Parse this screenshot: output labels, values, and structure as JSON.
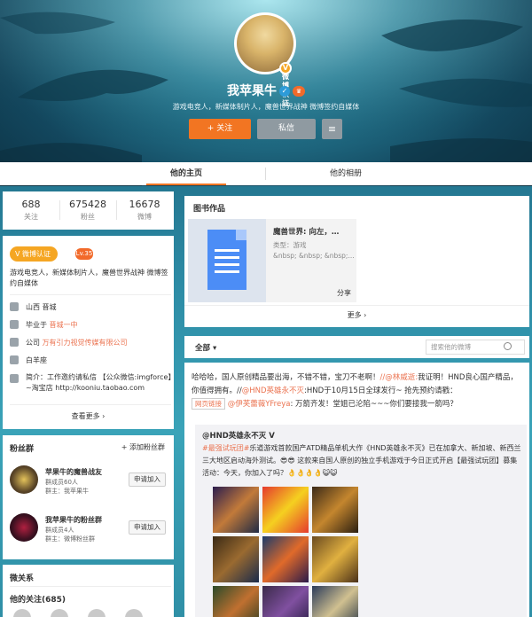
{
  "profile": {
    "username": "我苹果牛",
    "bio": "游戏电竞人，新媒体制片人，魔兽世界战神 微博签约自媒体",
    "follow_label": "+ 关注",
    "message_label": "私信",
    "menu_icon": "≡",
    "verified_icon": "✓",
    "level_icon": "♛"
  },
  "tabs": [
    "他的主页",
    "他的相册"
  ],
  "stats": [
    {
      "value": "688",
      "label": "关注"
    },
    {
      "value": "675428",
      "label": "粉丝"
    },
    {
      "value": "16678",
      "label": "微博"
    }
  ],
  "info": {
    "verified_label": "V 微博认证",
    "level_label": "Lv.35",
    "bio": "游戏电竞人，新媒体制片人，魔兽世界战神 微博签约自媒体",
    "location": "山西 晋城",
    "school_prefix": "毕业于 ",
    "school": "晋城一中",
    "company_prefix": "公司 ",
    "company": "万有引力视觉传媒有限公司",
    "sign": "白羊座",
    "intro": "简介：工作邀约请私信 【公众微信:imgforce】~淘宝店 http://kooniu.taobao.com",
    "more": "查看更多 ›"
  },
  "fans": {
    "title": "粉丝群",
    "add_label": "+ 添加粉丝群",
    "groups": [
      {
        "name": "苹果牛的魔兽战友",
        "members": "群成员60人",
        "owner": "群主：我苹果牛",
        "join": "申请加入"
      },
      {
        "name": "我苹果牛的粉丝群",
        "members": "群成员4人",
        "owner": "群主：微博粉丝群",
        "join": "申请加入"
      }
    ]
  },
  "relations": {
    "title": "微关系",
    "following": "他的关注(685)"
  },
  "books": {
    "title": "图书作品",
    "book_title": "魔兽世界: 向左，…",
    "book_type": "类型：游戏",
    "book_extra": "&nbsp; &nbsp; &nbsp;...",
    "share": "分享",
    "more": "更多 ›"
  },
  "filter": {
    "all": "全部 ▾",
    "search_placeholder": "搜索他的微博"
  },
  "post": {
    "line1": "哈哈哈，国人原创精品要出海，不错不错，宝刀不老啊！",
    "at1": "//@林威逝:",
    "line1b": "我证明！HND良心国",
    "line2a": "产精品，你值得拥有。//",
    "at2": "@HND英雄永不灭",
    "line2b": ":HND于10月15日全球发行~ 抢先预约请戳：",
    "webtag": "网页链接",
    "at3": "@伊芙蕾薇YFreya",
    "line3": ": 万箭齐发！堂姐已沦陷~~~你们要接我一箭吗？",
    "repost_author": "@HND英雄永不灭 V",
    "repost_hash": "#最强试玩团#",
    "repost_text": "乐道游戏首款国产ATD精品单机大作《HND英雄永不灭》已在加拿大、新加坡、新西兰三大地区启动海外测试。😎😎 这款来自国人原创的独立手机游戏于今日正式开启【最强试玩团】募集活动：今天，你加入了吗？👌👌👌👌😺😺"
  },
  "colors": {
    "accent": "#f27522",
    "link": "#eb7350",
    "verified": "#f5a623"
  }
}
